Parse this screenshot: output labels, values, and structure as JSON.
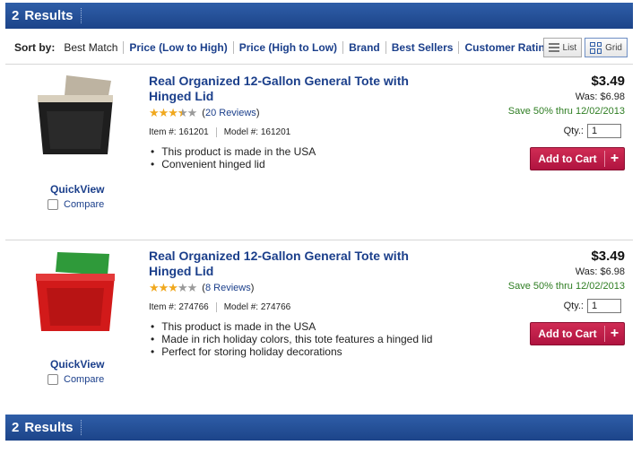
{
  "results": {
    "count": "2",
    "label": "Results"
  },
  "sort": {
    "label": "Sort by:",
    "options": [
      "Best Match",
      "Price (Low to High)",
      "Price (High to Low)",
      "Brand",
      "Best Sellers",
      "Customer Ratings"
    ]
  },
  "view": {
    "list_label": "List",
    "grid_label": "Grid"
  },
  "products": [
    {
      "title": "Real Organized 12-Gallon General Tote with Hinged Lid",
      "rating_stars": 3.5,
      "reviews": "20 Reviews",
      "item_no": "Item #: 161201",
      "model_no": "Model #: 161201",
      "bullets": [
        "This product is made in the USA",
        "Convenient hinged lid"
      ],
      "price": "$3.49",
      "was": "Was: $6.98",
      "save": "Save  50%  thru 12/02/2013",
      "qty_label": "Qty.:",
      "qty_value": "1",
      "add_to_cart": "Add to Cart",
      "quickview": "QuickView",
      "compare": "Compare",
      "colors": {
        "body": "#1e1e1e",
        "lid": "#bdb3a1"
      }
    },
    {
      "title": "Real Organized 12-Gallon General Tote with Hinged Lid",
      "rating_stars": 3,
      "reviews": "8 Reviews",
      "item_no": "Item #: 274766",
      "model_no": "Model #: 274766",
      "bullets": [
        "This product is made in the USA",
        "Made in rich holiday colors, this tote features a hinged lid",
        "Perfect for storing holiday decorations"
      ],
      "price": "$3.49",
      "was": "Was: $6.98",
      "save": "Save  50%  thru 12/02/2013",
      "qty_label": "Qty.:",
      "qty_value": "1",
      "add_to_cart": "Add to Cart",
      "quickview": "QuickView",
      "compare": "Compare",
      "colors": {
        "body": "#d21a1a",
        "lid": "#2f9a3a"
      }
    }
  ]
}
